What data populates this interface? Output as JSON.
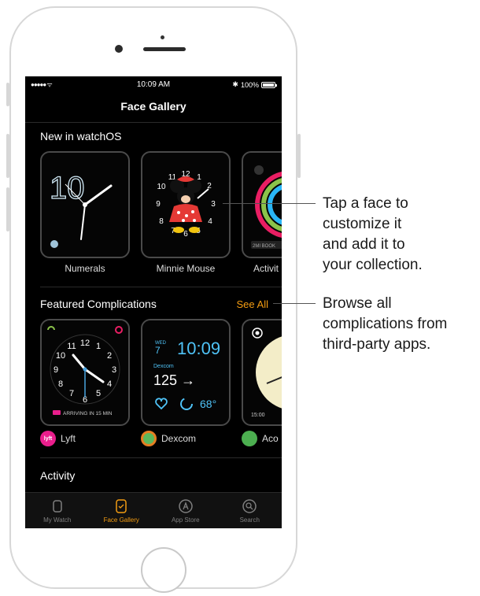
{
  "status_bar": {
    "signal": "●●●●● ",
    "wifi": "ᯤ",
    "time": "10:09 AM",
    "bluetooth": "✱",
    "battery": "100%"
  },
  "nav": {
    "title": "Face Gallery"
  },
  "sections": {
    "new": {
      "title": "New in watchOS",
      "cards": [
        {
          "label": "Numerals",
          "digit": "10"
        },
        {
          "label": "Minnie Mouse"
        },
        {
          "label": "Activit",
          "badge": "2MI BOOK"
        }
      ]
    },
    "featured": {
      "title": "Featured Complications",
      "see_all": "See All",
      "cards": [
        {
          "label": "Lyft",
          "icon_text": "lyft",
          "footer": "ARRIVING IN 15 MIN",
          "color": "#e91e8c"
        },
        {
          "label": "Dexcom",
          "day": "WED",
          "date": "7",
          "time": "10:09",
          "brand": "Dexcom",
          "reading": "125 →",
          "temp": "68°",
          "color": "#5cb85c"
        },
        {
          "label": "Aco",
          "footer": "15:00",
          "color": "#4caf50"
        }
      ]
    },
    "activity": {
      "title": "Activity"
    }
  },
  "tab_bar": {
    "tabs": [
      {
        "label": "My Watch",
        "icon": "watch-icon"
      },
      {
        "label": "Face Gallery",
        "icon": "face-gallery-icon",
        "active": true
      },
      {
        "label": "App Store",
        "icon": "app-store-icon"
      },
      {
        "label": "Search",
        "icon": "search-icon"
      }
    ]
  },
  "callouts": {
    "face": "Tap a face to customize it and add it to your collection.",
    "face_lines": [
      "Tap a face to",
      "customize it",
      "and add it to",
      "your collection."
    ],
    "browse_lines": [
      "Browse all",
      "complications from",
      "third-party apps."
    ]
  },
  "colors": {
    "accent": "#f39c12",
    "screen_bg": "#000000"
  }
}
